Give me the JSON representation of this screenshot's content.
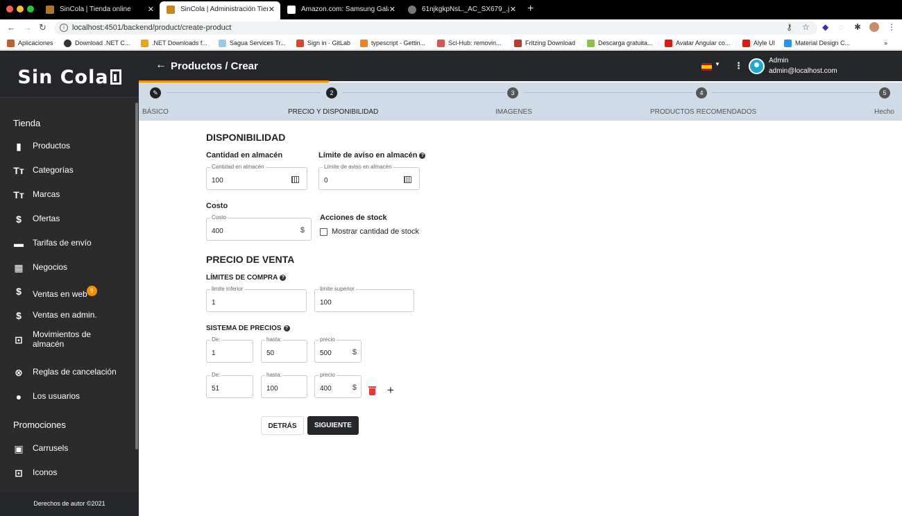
{
  "browser": {
    "tabs": [
      {
        "title": "SinCola | Tienda online",
        "active": false
      },
      {
        "title": "SinCola | Administración Tienda",
        "active": true
      },
      {
        "title": "Amazon.com: Samsung Galaxy",
        "active": false
      },
      {
        "title": "61njkgkpNsL._AC_SX679_.jpg",
        "active": false
      }
    ],
    "url": "localhost:4501/backend/product/create-product",
    "bookmarks": [
      "Aplicaciones",
      "Download .NET C...",
      ".NET Downloads f...",
      "Sagua Services Tr...",
      "Sign in · GitLab",
      "typescript - Gettin...",
      "Sci-Hub: removin...",
      "Fritzing Download",
      "Descarga gratuita...",
      "Avatar Angular co...",
      "Alyle UI",
      "Material Design C..."
    ],
    "more": "»"
  },
  "sidebar": {
    "logo": "Sin Cola",
    "section_store": "Tienda",
    "items": [
      {
        "label": "Productos",
        "icon": "bag-icon"
      },
      {
        "label": "Categorías",
        "icon": "text-size-icon"
      },
      {
        "label": "Marcas",
        "icon": "text-size-icon"
      },
      {
        "label": "Ofertas",
        "icon": "offer-icon"
      },
      {
        "label": "Tarifas de envío",
        "icon": "truck-icon"
      },
      {
        "label": "Negocios",
        "icon": "building-icon"
      },
      {
        "label": "Ventas en web",
        "icon": "dollar-icon",
        "badge": "9"
      },
      {
        "label": "Ventas en admin.",
        "icon": "dollar-icon"
      },
      {
        "label": "Movimientos de almacén",
        "icon": "warehouse-icon"
      },
      {
        "label": "Reglas de cancelación",
        "icon": "cancel-icon"
      },
      {
        "label": "Los usuarios",
        "icon": "person-icon"
      }
    ],
    "section_promo": "Promociones",
    "promo_items": [
      {
        "label": "Carrusels",
        "icon": "carousel-icon"
      },
      {
        "label": "Iconos",
        "icon": "icon-icon"
      }
    ],
    "footer": "Derechos de autor ©2021"
  },
  "header": {
    "title": "Productos / Crear",
    "user_name": "Admin",
    "user_email": "admin@localhost.com"
  },
  "stepper": {
    "steps": [
      {
        "num": "",
        "label": "BÁSICO"
      },
      {
        "num": "2",
        "label": "PRECIO Y DISPONIBILIDAD"
      },
      {
        "num": "3",
        "label": "IMAGENES"
      },
      {
        "num": "4",
        "label": "PRODUCTOS RECOMENDADOS"
      },
      {
        "num": "5",
        "label": "Hecho"
      }
    ]
  },
  "form": {
    "availability_title": "DISPONIBILIDAD",
    "stock_label": "Cantidad en almacén",
    "stock_field_label": "Cantidad en almacén",
    "stock_value": "100",
    "warn_label": "Límite de aviso en almacén",
    "warn_field_label": "Límite de aviso en almacén",
    "warn_value": "0",
    "cost_label": "Costo",
    "cost_field_label": "Costo",
    "cost_value": "400",
    "currency": "$",
    "stock_actions_label": "Acciones de stock",
    "show_stock_label": "Mostrar cantidad de stock",
    "sale_price_title": "PRECIO DE VENTA",
    "purchase_limits_label": "LÍMITES DE COMPRA",
    "lower_limit_label": "limite inferior",
    "lower_limit_value": "1",
    "upper_limit_label": "limite superior",
    "upper_limit_value": "100",
    "pricing_system_label": "SISTEMA DE PRECIOS",
    "price_rows": [
      {
        "from_label": "De:",
        "from": "1",
        "to_label": "hasta:",
        "to": "50",
        "price_label": "precio",
        "price": "500"
      },
      {
        "from_label": "De:",
        "from": "51",
        "to_label": "hasta:",
        "to": "100",
        "price_label": "precio",
        "price": "400"
      }
    ],
    "back_button": "DETRÁS",
    "next_button": "SIGUIENTE"
  },
  "colors": {
    "accent": "#f39200",
    "dark": "#25272b",
    "stepper_bg": "#cfdbe6",
    "delete": "#e53935"
  }
}
